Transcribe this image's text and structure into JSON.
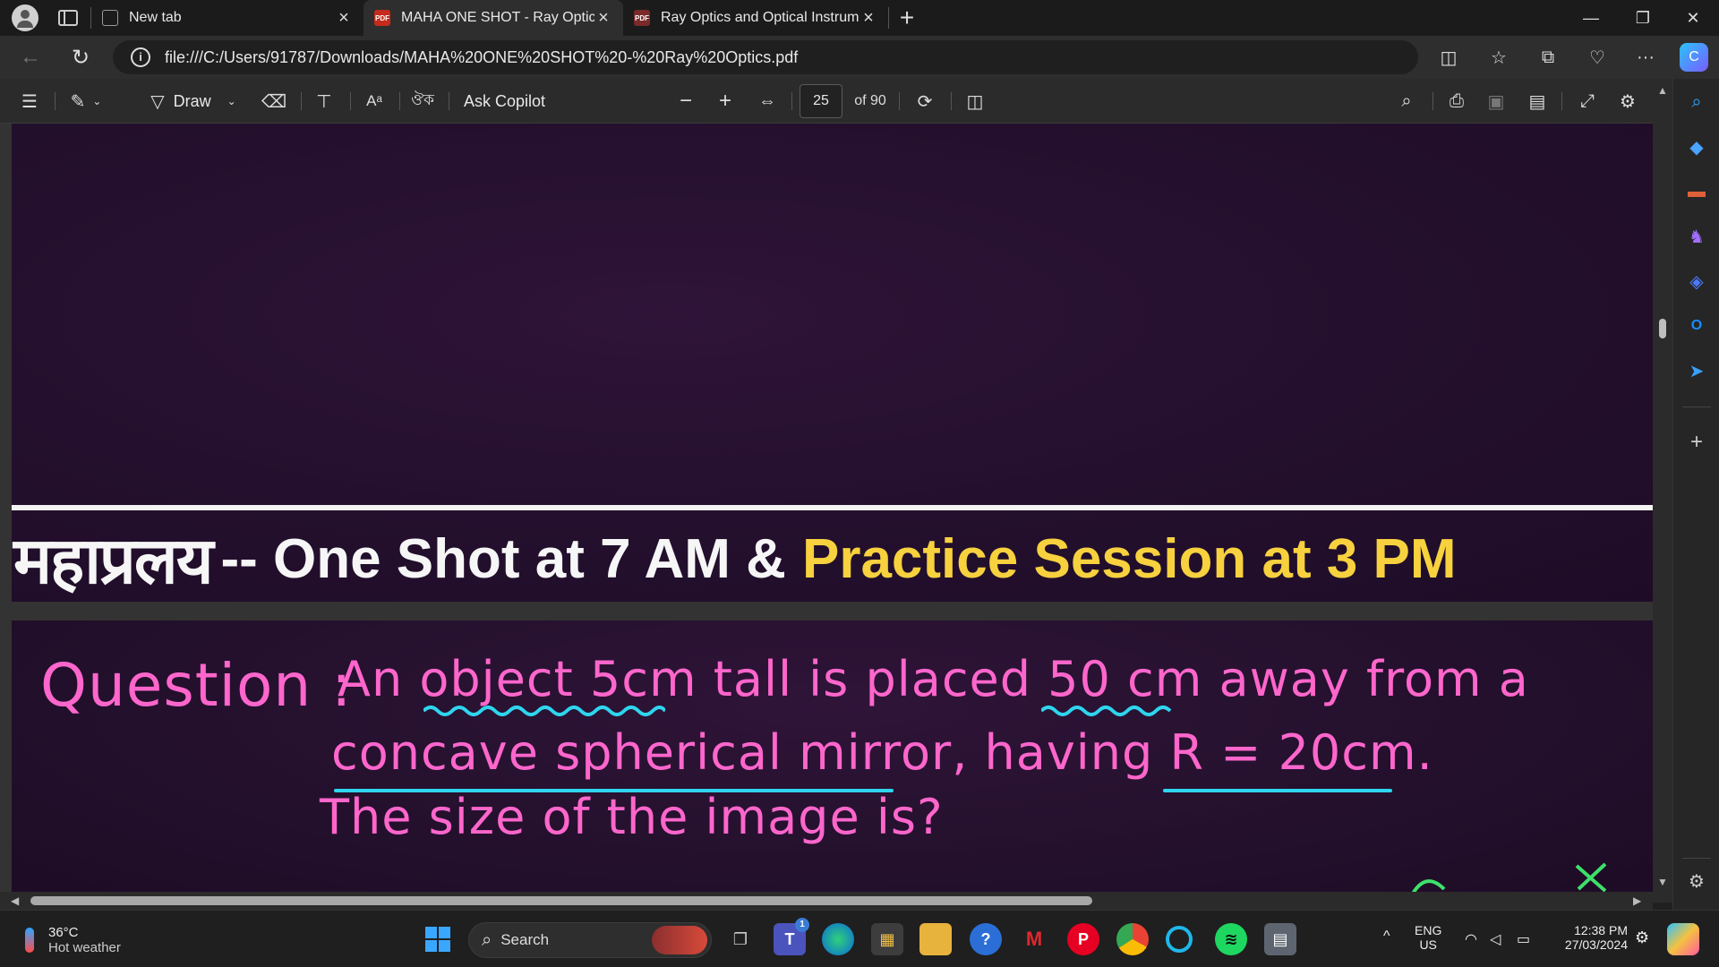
{
  "browser": {
    "tabs": [
      {
        "title": "New tab",
        "active": false
      },
      {
        "title": "MAHA ONE SHOT - Ray Optics.p",
        "active": true,
        "favicon": "PDF"
      },
      {
        "title": "Ray Optics and Optical Instrumer",
        "active": false,
        "favicon": "PDF"
      }
    ],
    "url": "file:///C:/Users/91787/Downloads/MAHA%20ONE%20SHOT%20-%20Ray%20Optics.pdf"
  },
  "pdf_toolbar": {
    "draw_label": "Draw",
    "ask_copilot_label": "Ask Copilot",
    "current_page": "25",
    "page_total": "of 90",
    "read_aloud_glyph": "Aᵃ",
    "translate_glyph": "ঔক"
  },
  "slide": {
    "banner_hindi": "महाप्रलय",
    "banner_white": "-- One Shot at 7 AM &",
    "banner_yellow": "Practice Session at 3 PM",
    "question": {
      "label": "Question :",
      "line1": "An object 5cm tall is placed 50 cm away from a",
      "line2": "concave spherical mirror, having R = 20cm.",
      "line3": "The size of the image is?"
    }
  },
  "taskbar": {
    "weather_temp": "36°C",
    "weather_desc": "Hot weather",
    "search_label": "Search",
    "teams_badge": "1",
    "language_top": "ENG",
    "language_bottom": "US",
    "time": "12:38 PM",
    "date": "27/03/2024"
  },
  "colors": {
    "banner_yellow": "#f7d13e",
    "handwriting_pink": "#ff66cc",
    "underline_cyan": "#2fd5ee",
    "slide_purple": "#24102e"
  }
}
